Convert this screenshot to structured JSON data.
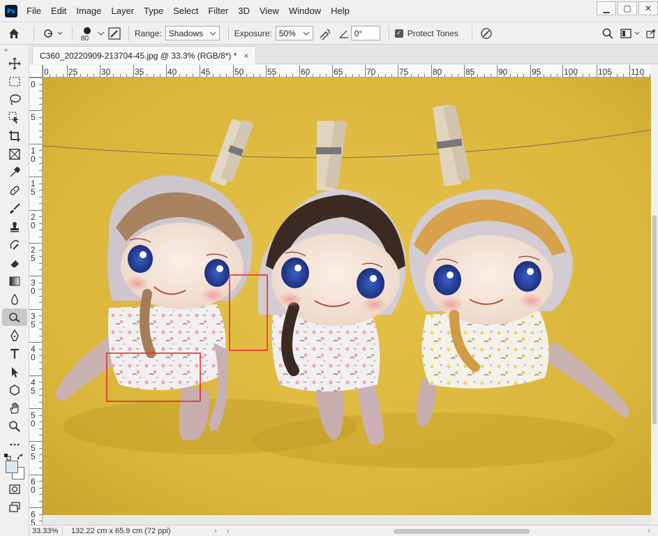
{
  "app": {
    "logo_text": "Ps"
  },
  "menu": [
    "File",
    "Edit",
    "Image",
    "Layer",
    "Type",
    "Select",
    "Filter",
    "3D",
    "View",
    "Window",
    "Help"
  ],
  "window_controls": {
    "minimize": "▁",
    "maximize": "▢",
    "close": "✕"
  },
  "options": {
    "brush_size": "80",
    "range_label": "Range:",
    "range_value": "Shadows",
    "exposure_label": "Exposure:",
    "exposure_value": "50%",
    "angle_value": "0°",
    "protect_tones_label": "Protect Tones",
    "protect_tones_checked": true
  },
  "document": {
    "tab_title": "C360_20220909-213704-45.jpg @ 33.3% (RGB/8*) *",
    "close_label": "×"
  },
  "ruler_top_labels": [
    "0",
    "25",
    "30",
    "35",
    "40",
    "45",
    "50",
    "55",
    "60",
    "65",
    "70",
    "75",
    "80",
    "85",
    "90",
    "95",
    "100",
    "105",
    "110"
  ],
  "ruler_left_labels": [
    "0",
    "5",
    "10",
    "15",
    "20",
    "25",
    "30",
    "35",
    "40",
    "45",
    "50",
    "55",
    "60",
    "65"
  ],
  "status": {
    "zoom": "33.33%",
    "doc_info": "132.22 cm x 65.9 cm (72 ppi)",
    "arrow": "›",
    "scroll_left": "‹",
    "scroll_right": "›"
  },
  "tools": [
    "move-tool",
    "marquee-tool",
    "lasso-tool",
    "object-select-tool",
    "crop-tool",
    "frame-tool",
    "eyedropper-tool",
    "healing-brush-tool",
    "brush-tool",
    "clone-stamp-tool",
    "history-brush-tool",
    "eraser-tool",
    "gradient-tool",
    "blur-tool",
    "burn-tool",
    "pen-tool",
    "type-tool",
    "path-select-tool",
    "shape-tool",
    "hand-tool",
    "zoom-tool",
    "more-tools"
  ],
  "colors": {
    "foreground": "#dde9f1",
    "background": "#ffffff",
    "canvas_bg": "#dcb83a",
    "selection_red": "#e53030"
  }
}
